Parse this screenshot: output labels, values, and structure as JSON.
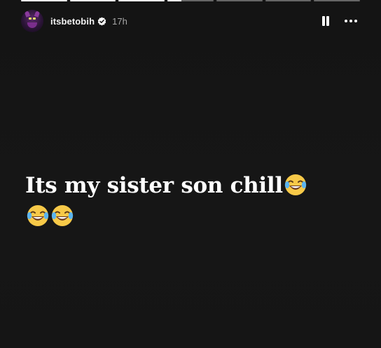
{
  "story": {
    "segments": [
      1,
      1,
      1,
      0.3,
      0,
      0,
      0
    ]
  },
  "header": {
    "username": "itsbetobih",
    "time": "17h",
    "avatar_icon": "demon-avatar-icon",
    "verified_icon": "verified-badge-icon",
    "pause_icon": "pause-icon",
    "more_icon": "more-options-icon"
  },
  "caption": {
    "text": "Its my sister son chill",
    "emoji_after_text": "😂",
    "emoji_line2": "😂😂"
  },
  "colors": {
    "background": "#141414",
    "text": "#ffffff",
    "muted": "#a8a8a8"
  }
}
